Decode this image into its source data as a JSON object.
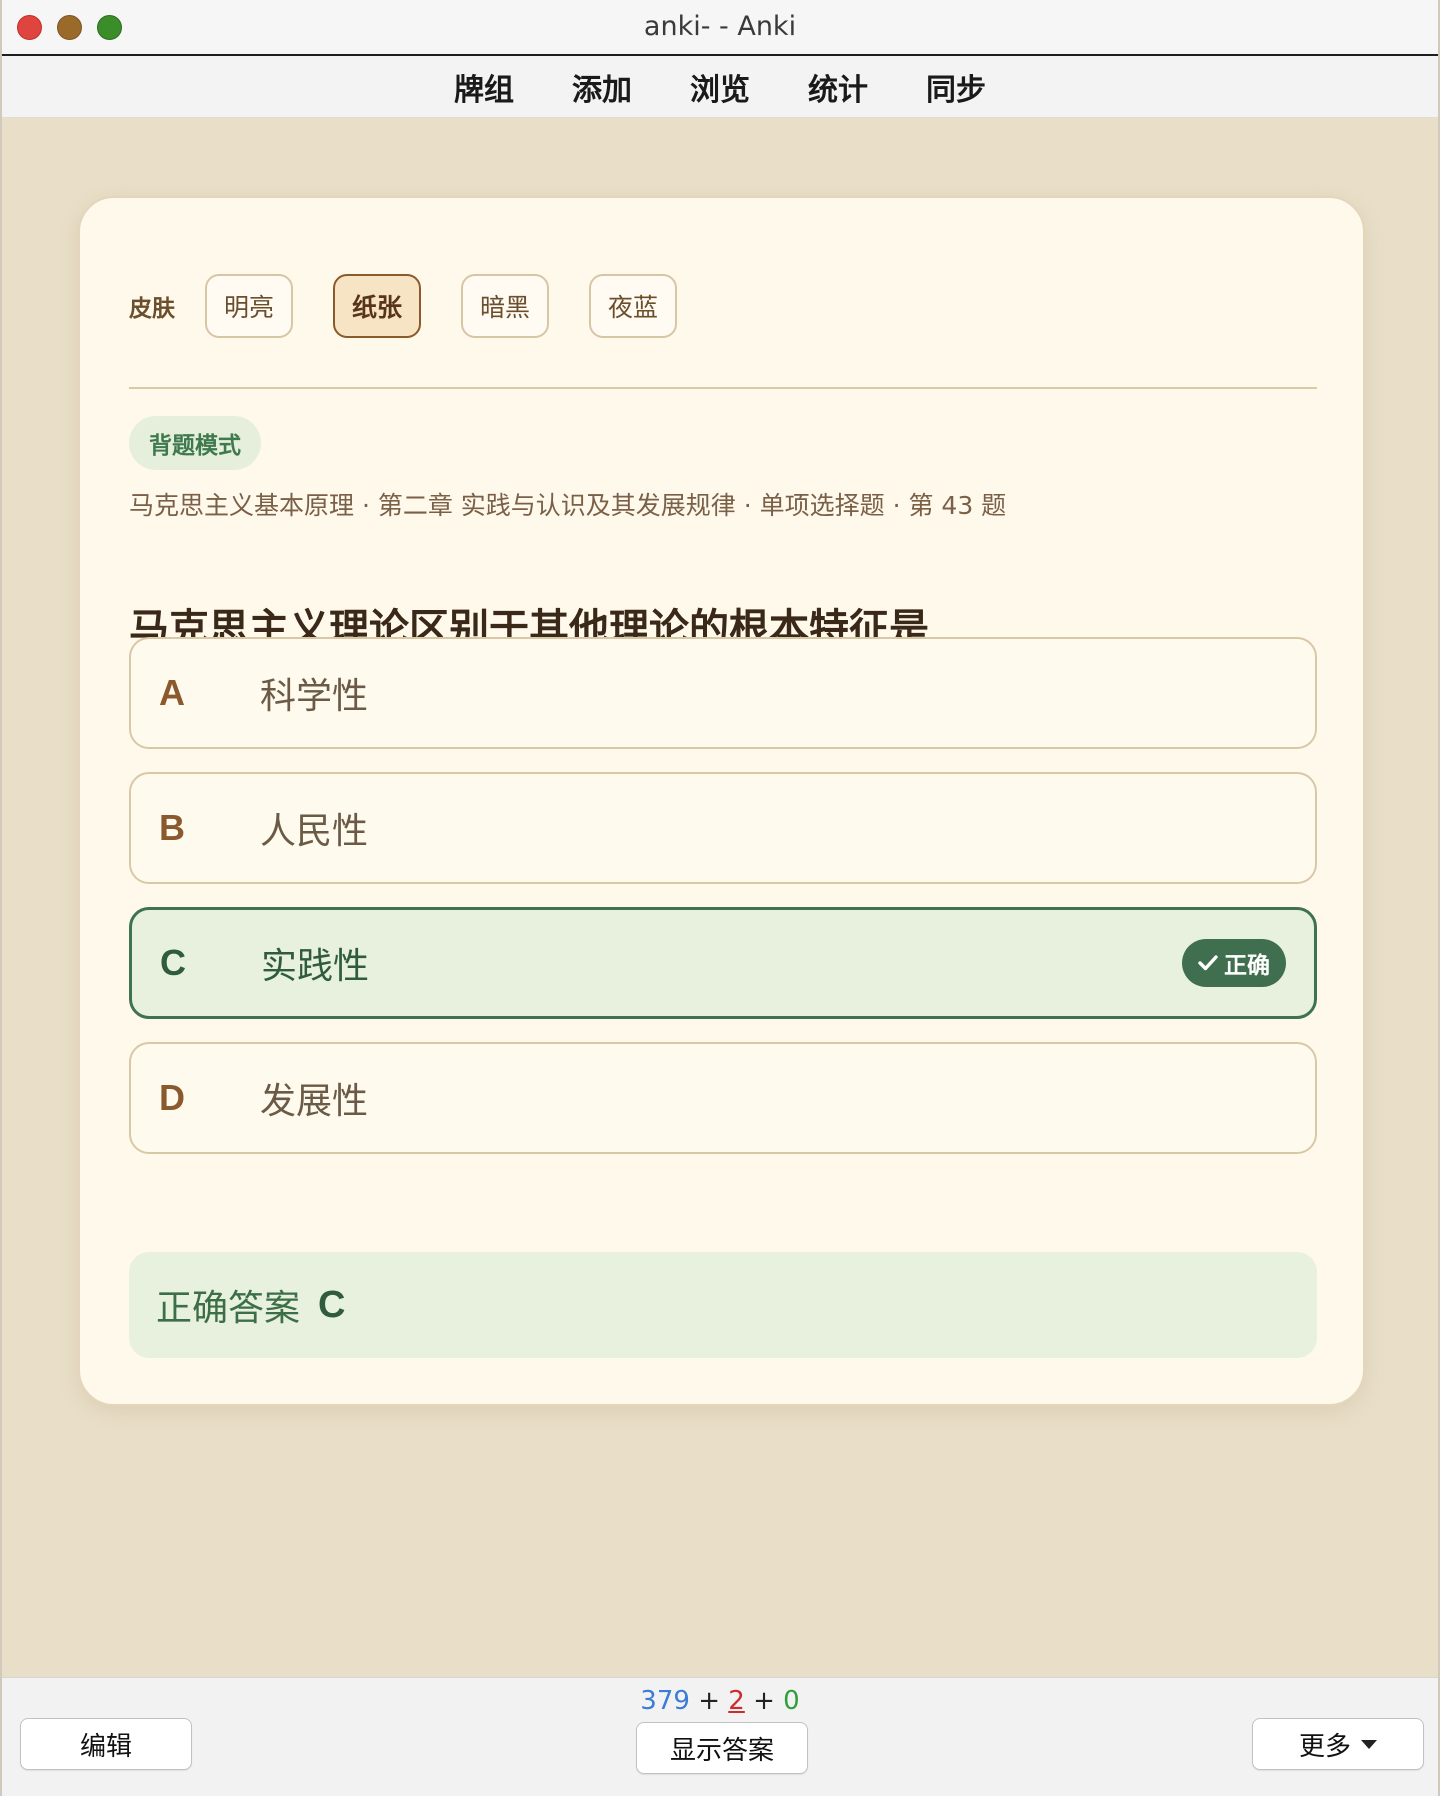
{
  "window": {
    "title": "anki- - Anki"
  },
  "nav": {
    "items": [
      "牌组",
      "添加",
      "浏览",
      "统计",
      "同步"
    ]
  },
  "card": {
    "skin_label": "皮肤",
    "skins": [
      "明亮",
      "纸张",
      "暗黑",
      "夜蓝"
    ],
    "active_skin": "纸张",
    "mode_badge": "背题模式",
    "breadcrumb": "马克思主义基本原理 · 第二章 实践与认识及其发展规律 · 单项选择题 · 第 43 题",
    "question": "马克思主义理论区别于其他理论的根本特征是",
    "options": [
      {
        "letter": "A",
        "text": "科学性"
      },
      {
        "letter": "B",
        "text": "人民性"
      },
      {
        "letter": "C",
        "text": "实践性",
        "correct": true
      },
      {
        "letter": "D",
        "text": "发展性"
      }
    ],
    "correct_tag": "正确",
    "answer_label": "正确答案",
    "answer_value": "C"
  },
  "bottom": {
    "counts": {
      "new": "379",
      "learn": "2",
      "review": "0",
      "sep": "+"
    },
    "edit_label": "编辑",
    "show_answer_label": "显示答案",
    "more_label": "更多"
  },
  "colors": {
    "background": "#e9dfc8",
    "card": "#fff9ec",
    "correct_green": "#3f6f4e",
    "accent_brown": "#8b5a2b"
  }
}
